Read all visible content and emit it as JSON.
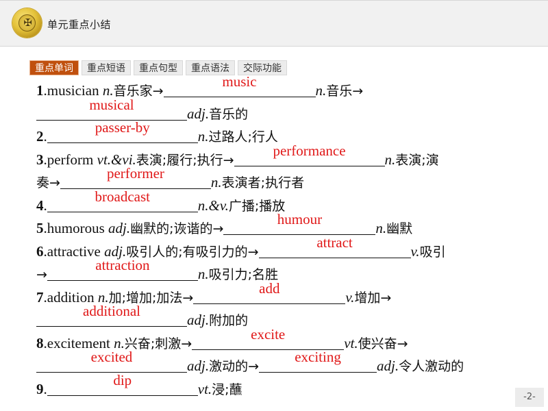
{
  "header": {
    "title": "单元重点小结",
    "logo_icon": "school-emblem-icon"
  },
  "tabs": [
    {
      "label": "重点单词",
      "active": true
    },
    {
      "label": "重点短语",
      "active": false
    },
    {
      "label": "重点句型",
      "active": false
    },
    {
      "label": "重点语法",
      "active": false
    },
    {
      "label": "交际功能",
      "active": false
    }
  ],
  "items": {
    "l1": {
      "num": "1",
      "word": ".musician ",
      "pos": "n.",
      "cn": "音乐家→",
      "ans": "music",
      "pos2": "n.",
      "cn2": "音乐→"
    },
    "l2": {
      "ans": "musical",
      "pos": "adj.",
      "cn": "音乐的"
    },
    "l3": {
      "num": "2",
      "ans": "passer-by",
      "pos": "n.",
      "cn": "过路人;行人"
    },
    "l4": {
      "num": "3",
      "word": ".perform ",
      "pos": "vt.&vi.",
      "cn": "表演;履行;执行→",
      "ans": "performance",
      "pos2": "n.",
      "cn2": "表演;演"
    },
    "l5": {
      "cn0": "奏→",
      "ans": "performer",
      "pos": "n.",
      "cn": "表演者;执行者"
    },
    "l6": {
      "num": "4",
      "ans": "broadcast",
      "pos": "n.&v.",
      "cn": "广播;播放"
    },
    "l7": {
      "num": "5",
      "word": ".humorous ",
      "pos": "adj.",
      "cn": "幽默的;诙谐的→",
      "ans": "humour",
      "pos2": "n.",
      "cn2": "幽默"
    },
    "l8": {
      "num": "6",
      "word": ".attractive ",
      "pos": "adj.",
      "cn": "吸引人的;有吸引力的→",
      "ans": "attract",
      "pos2": "v.",
      "cn2": "吸引"
    },
    "l9": {
      "cn0": "→",
      "ans": "attraction",
      "pos": "n.",
      "cn": "吸引力;名胜"
    },
    "l10": {
      "num": "7",
      "word": ".addition ",
      "pos": "n.",
      "cn": "加;增加;加法→",
      "ans": "add",
      "pos2": "v.",
      "cn2": "增加→"
    },
    "l11": {
      "ans": "additional",
      "pos": "adj.",
      "cn": "附加的"
    },
    "l12": {
      "num": "8",
      "word": ".excitement ",
      "pos": "n.",
      "cn": "兴奋;刺激→",
      "ans": "excite",
      "pos2": "vt.",
      "cn2": "使兴奋→"
    },
    "l13": {
      "ans": "excited",
      "pos": "adj.",
      "cn": "激动的→",
      "ans2": "exciting",
      "pos2": "adj.",
      "cn2": "令人激动的"
    },
    "l14": {
      "num": "9",
      "ans": "dip",
      "pos": "vt.",
      "cn": "浸;蘸"
    }
  },
  "page_number": "-2-",
  "colors": {
    "answer": "#e01818",
    "active_tab": "#c0500e",
    "header_bg": "#f1f1f1"
  }
}
